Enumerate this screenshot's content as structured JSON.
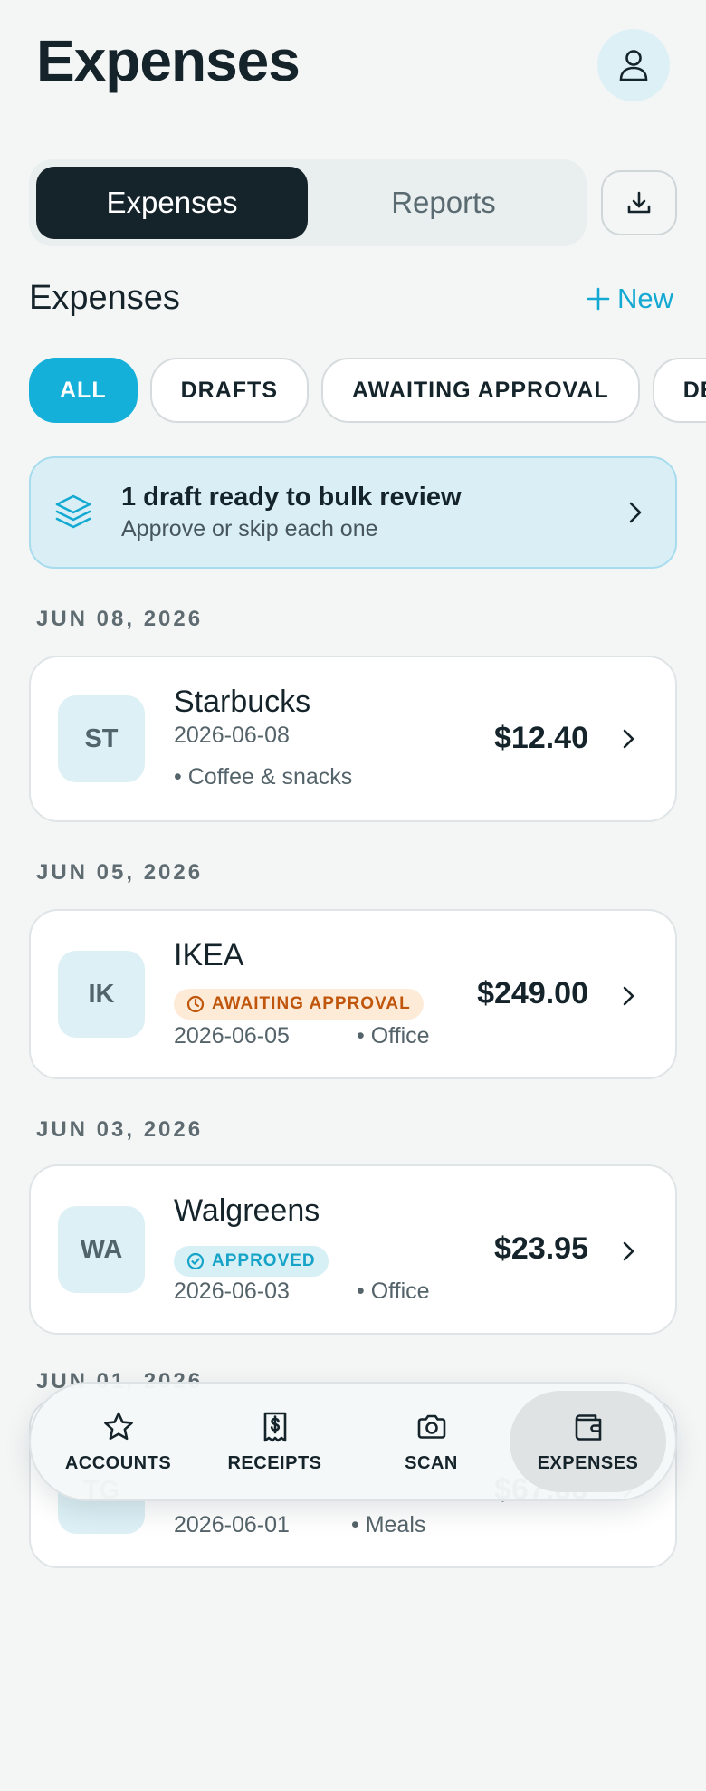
{
  "header": {
    "title": "Expenses"
  },
  "tabs": [
    {
      "label": "Expenses",
      "active": true
    },
    {
      "label": "Reports",
      "active": false
    }
  ],
  "section": {
    "title": "Expenses",
    "new_label": "New"
  },
  "filters": [
    {
      "label": "ALL",
      "active": true
    },
    {
      "label": "DRAFTS",
      "active": false
    },
    {
      "label": "AWAITING APPROVAL",
      "active": false
    },
    {
      "label": "DENIED",
      "active": false
    }
  ],
  "banner": {
    "title": "1 draft ready to bulk review",
    "subtitle": "Approve or skip each one"
  },
  "groups": [
    {
      "date": "JUN 08, 2026",
      "expense": {
        "initials": "ST",
        "merchant": "Starbucks",
        "date": "2026-06-08",
        "category": "• Coffee & snacks",
        "amount": "$12.40"
      }
    },
    {
      "date": "JUN 05, 2026",
      "expense": {
        "initials": "IK",
        "merchant": "IKEA",
        "status": "AWAITING APPROVAL",
        "date": "2026-06-05",
        "category": "• Office",
        "amount": "$249.00"
      }
    },
    {
      "date": "JUN 03, 2026",
      "expense": {
        "initials": "WA",
        "merchant": "Walgreens",
        "status": "APPROVED",
        "date": "2026-06-03",
        "category": "• Office",
        "amount": "$23.95"
      }
    },
    {
      "date": "JUN 01, 2026",
      "expense": {
        "initials": "TG",
        "date": "2026-06-01",
        "category": "• Meals",
        "amount": "$67.00"
      }
    }
  ],
  "bottom_nav": [
    {
      "label": "ACCOUNTS",
      "icon": "star-icon"
    },
    {
      "label": "RECEIPTS",
      "icon": "receipt-icon"
    },
    {
      "label": "SCAN",
      "icon": "camera-icon"
    },
    {
      "label": "EXPENSES",
      "icon": "wallet-icon",
      "active": true
    }
  ],
  "colors": {
    "accent": "#15b0d9",
    "dark": "#15232a",
    "awaiting": "#c0560c",
    "approved": "#16a3c8"
  }
}
